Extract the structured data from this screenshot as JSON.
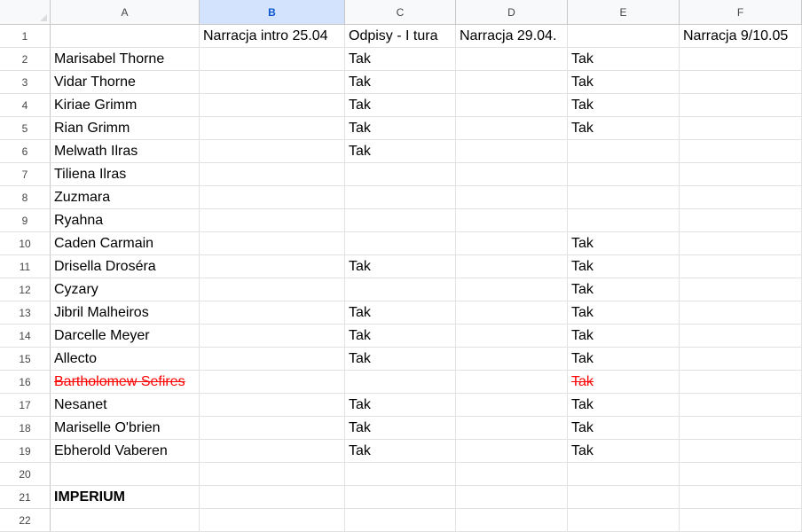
{
  "columns": [
    {
      "letter": "A",
      "selected": false
    },
    {
      "letter": "B",
      "selected": true
    },
    {
      "letter": "C",
      "selected": false
    },
    {
      "letter": "D",
      "selected": false
    },
    {
      "letter": "E",
      "selected": false
    },
    {
      "letter": "F",
      "selected": false
    }
  ],
  "rows": [
    {
      "num": "1",
      "cells": [
        "",
        "Narracja intro 25.04",
        "Odpisy - I tura",
        "Narracja 29.04.",
        "",
        "Narracja 9/10.05"
      ]
    },
    {
      "num": "2",
      "cells": [
        "Marisabel Thorne",
        "",
        "Tak",
        "",
        "Tak",
        ""
      ]
    },
    {
      "num": "3",
      "cells": [
        "Vidar Thorne",
        "",
        "Tak",
        "",
        "Tak",
        ""
      ]
    },
    {
      "num": "4",
      "cells": [
        "Kiriae Grimm",
        "",
        "Tak",
        "",
        "Tak",
        ""
      ]
    },
    {
      "num": "5",
      "cells": [
        "Rian Grimm",
        "",
        "Tak",
        "",
        "Tak",
        ""
      ]
    },
    {
      "num": "6",
      "cells": [
        "Melwath Ilras",
        "",
        "Tak",
        "",
        "",
        ""
      ]
    },
    {
      "num": "7",
      "cells": [
        "Tiliena Ilras",
        "",
        "",
        "",
        "",
        ""
      ]
    },
    {
      "num": "8",
      "cells": [
        "Zuzmara",
        "",
        "",
        "",
        "",
        ""
      ]
    },
    {
      "num": "9",
      "cells": [
        "Ryahna",
        "",
        "",
        "",
        "",
        ""
      ]
    },
    {
      "num": "10",
      "cells": [
        "Caden Carmain",
        "",
        "",
        "",
        "Tak",
        ""
      ]
    },
    {
      "num": "11",
      "cells": [
        "Drisella Droséra",
        "",
        "Tak",
        "",
        "Tak",
        ""
      ]
    },
    {
      "num": "12",
      "cells": [
        "Cyzary",
        "",
        "",
        "",
        "Tak",
        ""
      ]
    },
    {
      "num": "13",
      "cells": [
        "Jibril Malheiros",
        "",
        "Tak",
        "",
        "Tak",
        ""
      ]
    },
    {
      "num": "14",
      "cells": [
        "Darcelle Meyer",
        "",
        "Tak",
        "",
        "Tak",
        ""
      ]
    },
    {
      "num": "15",
      "cells": [
        "Allecto",
        "",
        "Tak",
        "",
        "Tak",
        ""
      ]
    },
    {
      "num": "16",
      "cells": [
        "Bartholomew Sefires",
        "",
        "",
        "",
        "Tak",
        ""
      ],
      "strike": true
    },
    {
      "num": "17",
      "cells": [
        "Nesanet",
        "",
        "Tak",
        "",
        "Tak",
        ""
      ]
    },
    {
      "num": "18",
      "cells": [
        "Mariselle O'brien",
        "",
        "Tak",
        "",
        "Tak",
        ""
      ]
    },
    {
      "num": "19",
      "cells": [
        "Ebherold Vaberen",
        "",
        "Tak",
        "",
        "Tak",
        ""
      ]
    },
    {
      "num": "20",
      "cells": [
        "",
        "",
        "",
        "",
        "",
        ""
      ]
    },
    {
      "num": "21",
      "cells": [
        "IMPERIUM",
        "",
        "",
        "",
        "",
        ""
      ],
      "bold": true
    },
    {
      "num": "22",
      "cells": [
        "",
        "",
        "",
        "",
        "",
        ""
      ]
    }
  ],
  "colors": {
    "strike_text": "#ff0000",
    "selected_header_bg": "#d3e3fd",
    "selected_header_text": "#0b57d0"
  }
}
